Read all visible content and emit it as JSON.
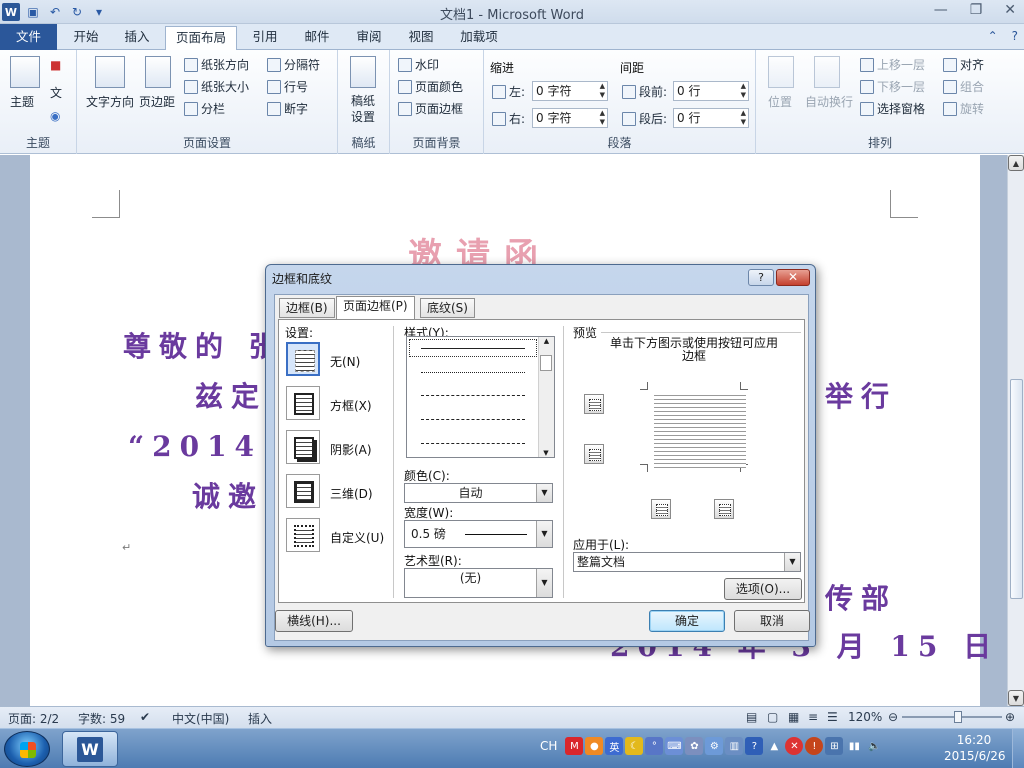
{
  "window": {
    "title": "文档1 - Microsoft Word",
    "word_icon": "W"
  },
  "tabs": {
    "file": "文件",
    "home": "开始",
    "insert": "插入",
    "page_layout": "页面布局",
    "references": "引用",
    "mailings": "邮件",
    "review": "审阅",
    "view": "视图",
    "addins": "加载项"
  },
  "ribbon": {
    "themes": {
      "label": "主题",
      "themes_btn": "主题",
      "colors_btn": "■",
      "fonts_btn": "文",
      "effects_btn": "◉"
    },
    "page_setup": {
      "label": "页面设置",
      "text_direction": "文字方向",
      "margins": "页边距",
      "orientation": "纸张方向",
      "size": "纸张大小",
      "columns": "分栏",
      "breaks": "分隔符",
      "line_numbers": "行号",
      "hyphenation": "断字"
    },
    "draft": {
      "label": "稿纸",
      "draft_settings": "稿纸\n设置"
    },
    "page_background": {
      "label": "页面背景",
      "watermark": "水印",
      "page_color": "页面颜色",
      "page_borders": "页面边框"
    },
    "paragraph": {
      "label": "段落",
      "indent": "缩进",
      "spacing": "间距",
      "left_label": "左:",
      "right_label": "右:",
      "before_label": "段前:",
      "after_label": "段后:",
      "left_value": "0 字符",
      "right_value": "0 字符",
      "before_value": "0 行",
      "after_value": "0 行"
    },
    "arrange": {
      "label": "排列",
      "position": "位置",
      "wrap_text": "自动换行",
      "bring_forward": "上移一层",
      "send_backward": "下移一层",
      "selection_pane": "选择窗格",
      "align": "对齐",
      "group": "组合",
      "rotate": "旋转"
    }
  },
  "document": {
    "heading": "邀请函",
    "line1": "尊敬的 张",
    "line2a": "兹定",
    "line2b": "举行",
    "line3": "“2014 年",
    "line4": "诚邀",
    "sign1": "传部",
    "sign2": "2014 年 3 月 15 日",
    "para_mark": "↵"
  },
  "dialog": {
    "title": "边框和底纹",
    "help": "?",
    "close": "✕",
    "tabs": [
      "边框(B)",
      "页面边框(P)",
      "底纹(S)"
    ],
    "settings_label": "设置:",
    "settings": [
      "无(N)",
      "方框(X)",
      "阴影(A)",
      "三维(D)",
      "自定义(U)"
    ],
    "style_label": "样式(Y):",
    "color_label": "颜色(C):",
    "color_value": "自动",
    "width_label": "宽度(W):",
    "width_value": "0.5 磅",
    "art_label": "艺术型(R):",
    "art_value": "(无)",
    "preview_label": "预览",
    "preview_hint": "单击下方图示或使用按钮可应用边框",
    "apply_to_label": "应用于(L):",
    "apply_to_value": "整篇文档",
    "options_btn": "选项(O)...",
    "horizontal_line_btn": "横线(H)...",
    "ok_btn": "确定",
    "cancel_btn": "取消"
  },
  "statusbar": {
    "page": "页面: 2/2",
    "words": "字数: 59",
    "language": "中文(中国)",
    "mode": "插入",
    "zoom": "120%",
    "zoom_fraction": 0.55
  },
  "taskbar": {
    "ime": "CH",
    "time": "16:20",
    "date": "2015/6/26"
  }
}
